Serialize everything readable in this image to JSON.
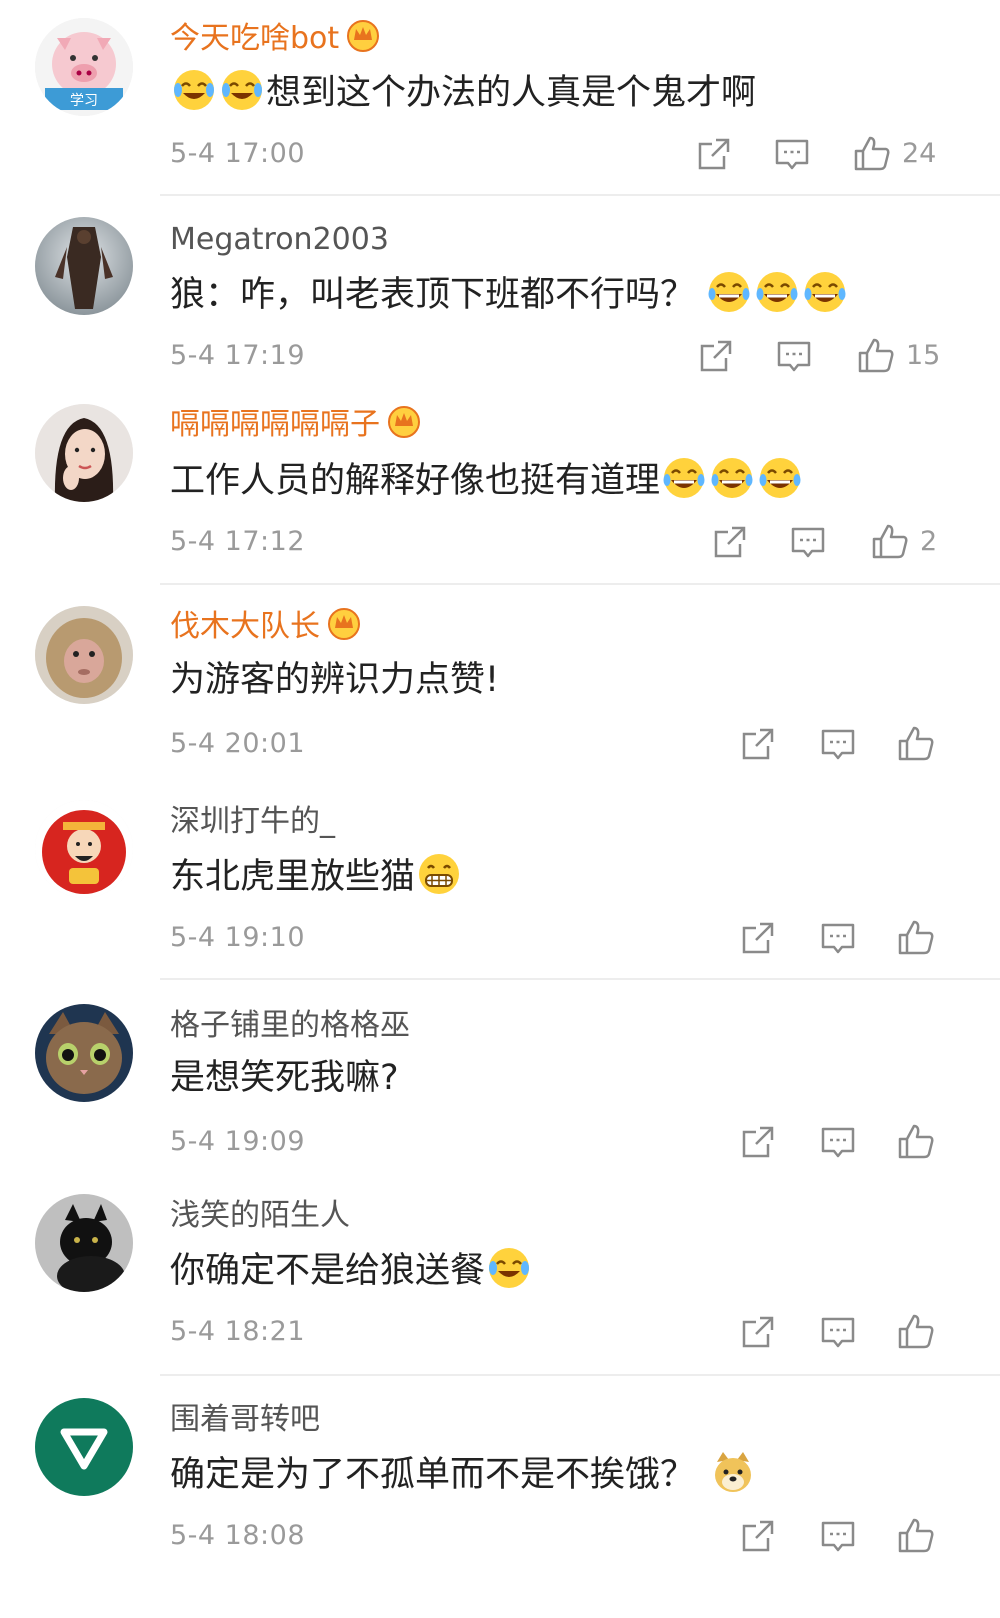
{
  "comments": [
    {
      "user": "今天吃啥bot",
      "vip": true,
      "avatar_icon": "pig-avatar-icon",
      "text": "想到这个办法的人真是个鬼才啊",
      "emojis_before": [
        "crying-laugh-emoji",
        "crying-laugh-emoji"
      ],
      "emojis_after": [],
      "time": "5-4 17:00",
      "likes": "24"
    },
    {
      "user": "Megatron2003",
      "vip": false,
      "avatar_icon": "robot-avatar-icon",
      "text": "狼：咋，叫老表顶下班都不行吗？",
      "emojis_before": [],
      "emojis_after": [
        "laughing-emoji",
        "laughing-emoji",
        "laughing-emoji"
      ],
      "time": "5-4 17:19",
      "likes": "15"
    },
    {
      "user": "嗝嗝嗝嗝嗝嗝子",
      "vip": true,
      "avatar_icon": "girl-avatar-icon",
      "text": "工作人员的解释好像也挺有道理",
      "emojis_before": [],
      "emojis_after": [
        "laughing-emoji",
        "laughing-emoji",
        "laughing-emoji"
      ],
      "time": "5-4 17:12",
      "likes": "2"
    },
    {
      "user": "伐木大队长",
      "vip": true,
      "avatar_icon": "monkey-avatar-icon",
      "text": "为游客的辨识力点赞!",
      "emojis_before": [],
      "emojis_after": [],
      "time": "5-4 20:01",
      "likes": ""
    },
    {
      "user": "深圳打牛的_",
      "vip": false,
      "avatar_icon": "fortune-god-avatar-icon",
      "text": "东北虎里放些猫",
      "emojis_before": [],
      "emojis_after": [
        "grin-emoji"
      ],
      "time": "5-4 19:10",
      "likes": ""
    },
    {
      "user": "格子铺里的格格巫",
      "vip": false,
      "avatar_icon": "cat-avatar-icon",
      "text": "是想笑死我嘛?",
      "emojis_before": [],
      "emojis_after": [],
      "time": "5-4 19:09",
      "likes": ""
    },
    {
      "user": "浅笑的陌生人",
      "vip": false,
      "avatar_icon": "black-cat-avatar-icon",
      "text": "你确定不是给狼送餐",
      "emojis_before": [],
      "emojis_after": [
        "crying-laugh-emoji"
      ],
      "time": "5-4 18:21",
      "likes": ""
    },
    {
      "user": "围着哥转吧",
      "vip": false,
      "avatar_icon": "green-triangle-avatar-icon",
      "text": "确定是为了不孤单而不是不挨饿？",
      "emojis_before": [],
      "emojis_after": [
        "doge-emoji"
      ],
      "time": "5-4 18:08",
      "likes": ""
    }
  ],
  "colors": {
    "vip_name": "#e8731e",
    "normal_name": "#555555",
    "text": "#222222",
    "meta": "#9a9a9a",
    "divider": "#ededed"
  },
  "action_icons": [
    "repost-icon",
    "reply-icon",
    "like-icon"
  ]
}
